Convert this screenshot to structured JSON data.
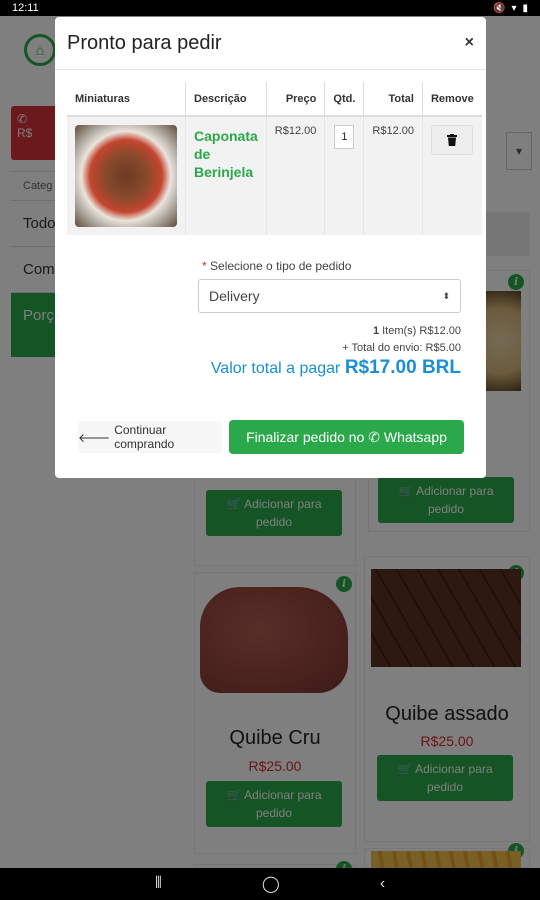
{
  "status_bar": {
    "time": "12:11"
  },
  "background": {
    "whatsapp_button_label": "R$",
    "categories_label": "Categ",
    "sidebar_items": [
      "Todo",
      "Com",
      "Porç Indiv"
    ],
    "products": [
      {
        "title": "Quibe Cru",
        "price": "R$25.00",
        "add_label": "Adicionar para pedido"
      },
      {
        "title": "Quibe assado",
        "price": "R$25.00",
        "add_label": "Adicionar para pedido"
      },
      {
        "add_label": "Adicionar para pedido"
      },
      {
        "add_label": "Adicionar para pedido"
      }
    ]
  },
  "modal": {
    "title": "Pronto para pedir",
    "close_symbol": "×",
    "table": {
      "headers": [
        "Miniaturas",
        "Descrição",
        "Preço",
        "Qtd.",
        "Total",
        "Remove"
      ],
      "rows": [
        {
          "name": "Caponata de Berinjela",
          "price": "R$12.00",
          "qty": "1",
          "total": "R$12.00"
        }
      ]
    },
    "order_type": {
      "required_mark": "*",
      "label": "Selecione o tipo de pedido",
      "selected": "Delivery"
    },
    "summary": {
      "items_count": "1",
      "items_text": "Item(s) R$12.00",
      "shipping_text": "+ Total do envio: R$5.00"
    },
    "total": {
      "label": "Valor total a pagar",
      "value": "R$17.00 BRL"
    },
    "buttons": {
      "continue": "Continuar comprando",
      "finalize": "Finalizar pedido no Whatsapp"
    }
  }
}
